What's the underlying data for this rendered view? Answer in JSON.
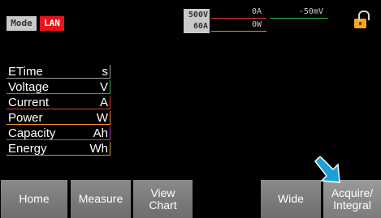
{
  "header": {
    "mode_label": "Mode",
    "lan_label": "LAN",
    "rated_voltage": "500V",
    "rated_current": "60A",
    "current_reading": "0A",
    "power_reading": "0W",
    "voltage_reading": "-50mV"
  },
  "params": [
    {
      "label": "ETime",
      "unit": "s",
      "color": "#9e9e9e"
    },
    {
      "label": "Voltage",
      "unit": "V",
      "color": "#2db34a"
    },
    {
      "label": "Current",
      "unit": "A",
      "color": "#e53935"
    },
    {
      "label": "Power",
      "unit": "W",
      "color": "#f28c28"
    },
    {
      "label": "Capacity",
      "unit": "Ah",
      "color": "#c02fd0"
    },
    {
      "label": "Energy",
      "unit": "Wh",
      "color": "#c9a227"
    }
  ],
  "softkeys": {
    "home": "Home",
    "measure": "Measure",
    "view_chart": "View\nChart",
    "wide": "Wide",
    "acquire": "Acquire/\nIntegral"
  },
  "colors": {
    "lan_bg": "#e8141b",
    "lock": "#f5a623",
    "arrow": "#1aa0d8"
  }
}
